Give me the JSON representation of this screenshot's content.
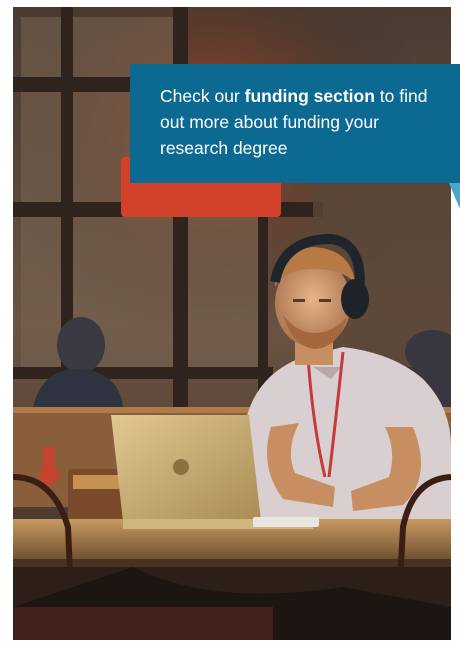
{
  "callout": {
    "text_before": "Check our ",
    "link_text": "funding section",
    "text_after": " to find out more about funding your research degree",
    "background_color": "#0c6a92",
    "tail_color": "#4aa6cf"
  },
  "photo": {
    "subject": "student-with-headphones-using-laptop-in-cafe"
  }
}
